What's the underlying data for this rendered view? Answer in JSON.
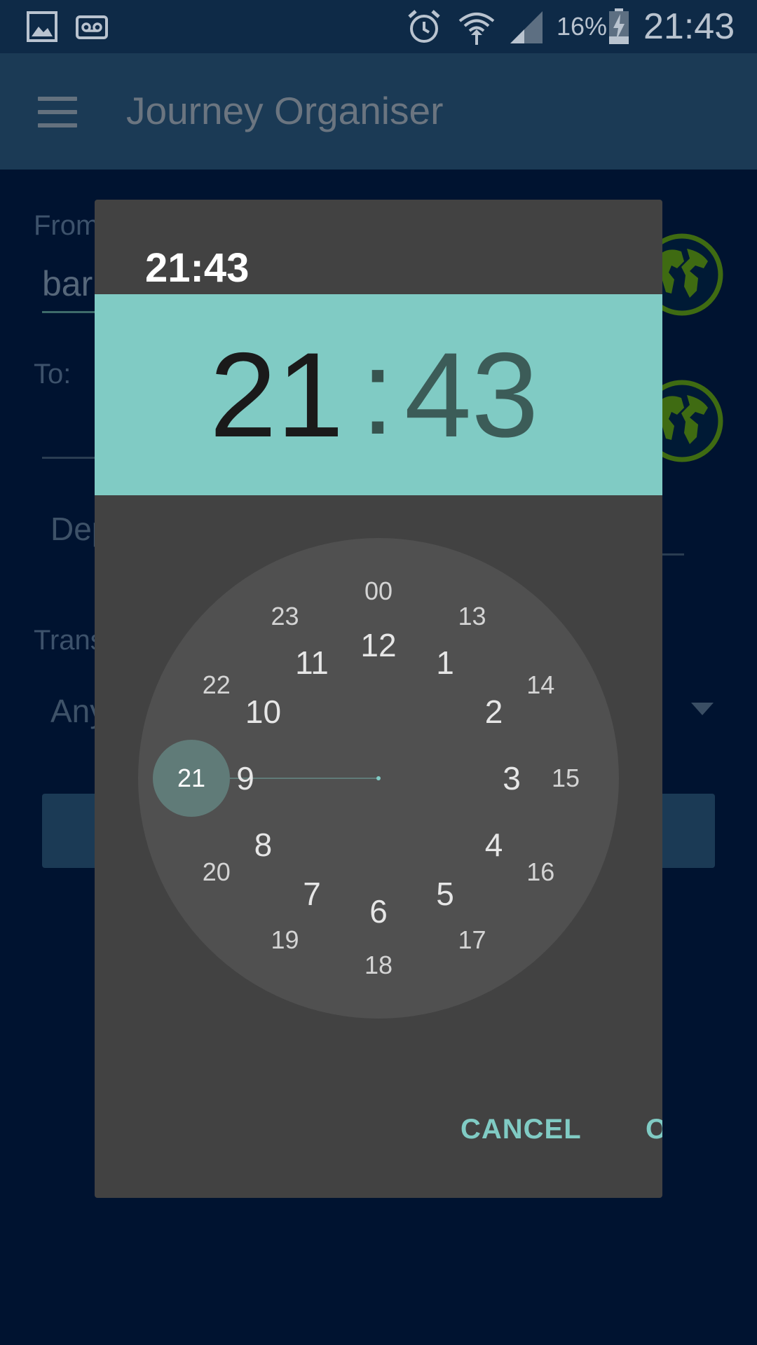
{
  "status_bar": {
    "clock": "21:43",
    "battery_percent": "16%",
    "icons": [
      "image-icon",
      "voicemail-icon",
      "alarm-icon",
      "wifi-icon",
      "signal-icon",
      "battery-charging-icon"
    ]
  },
  "app_bar": {
    "title": "Journey Organiser",
    "menu_icon": "hamburger-menu-icon"
  },
  "background_form": {
    "from_label": "From",
    "from_value": "bar",
    "to_label": "To:",
    "depart_label": "Dep",
    "transport_label": "Trans",
    "transport_value": "Any",
    "globe_icon": "globe-icon"
  },
  "dialog": {
    "title": "21:43",
    "hour": "21",
    "colon": ":",
    "minute": "43",
    "selected_hour": "21",
    "outer_numbers": [
      "12",
      "1",
      "2",
      "3",
      "4",
      "5",
      "6",
      "7",
      "8",
      "9",
      "10",
      "11"
    ],
    "inner_numbers": [
      "00",
      "13",
      "14",
      "15",
      "16",
      "17",
      "18",
      "19",
      "20",
      "21",
      "22",
      "23"
    ],
    "cancel_label": "CANCEL",
    "ok_label": "OK",
    "colors": {
      "accent": "#80cbc4",
      "dialog_bg": "#424242",
      "face_bg": "#505050",
      "selector": "#607b78"
    }
  }
}
